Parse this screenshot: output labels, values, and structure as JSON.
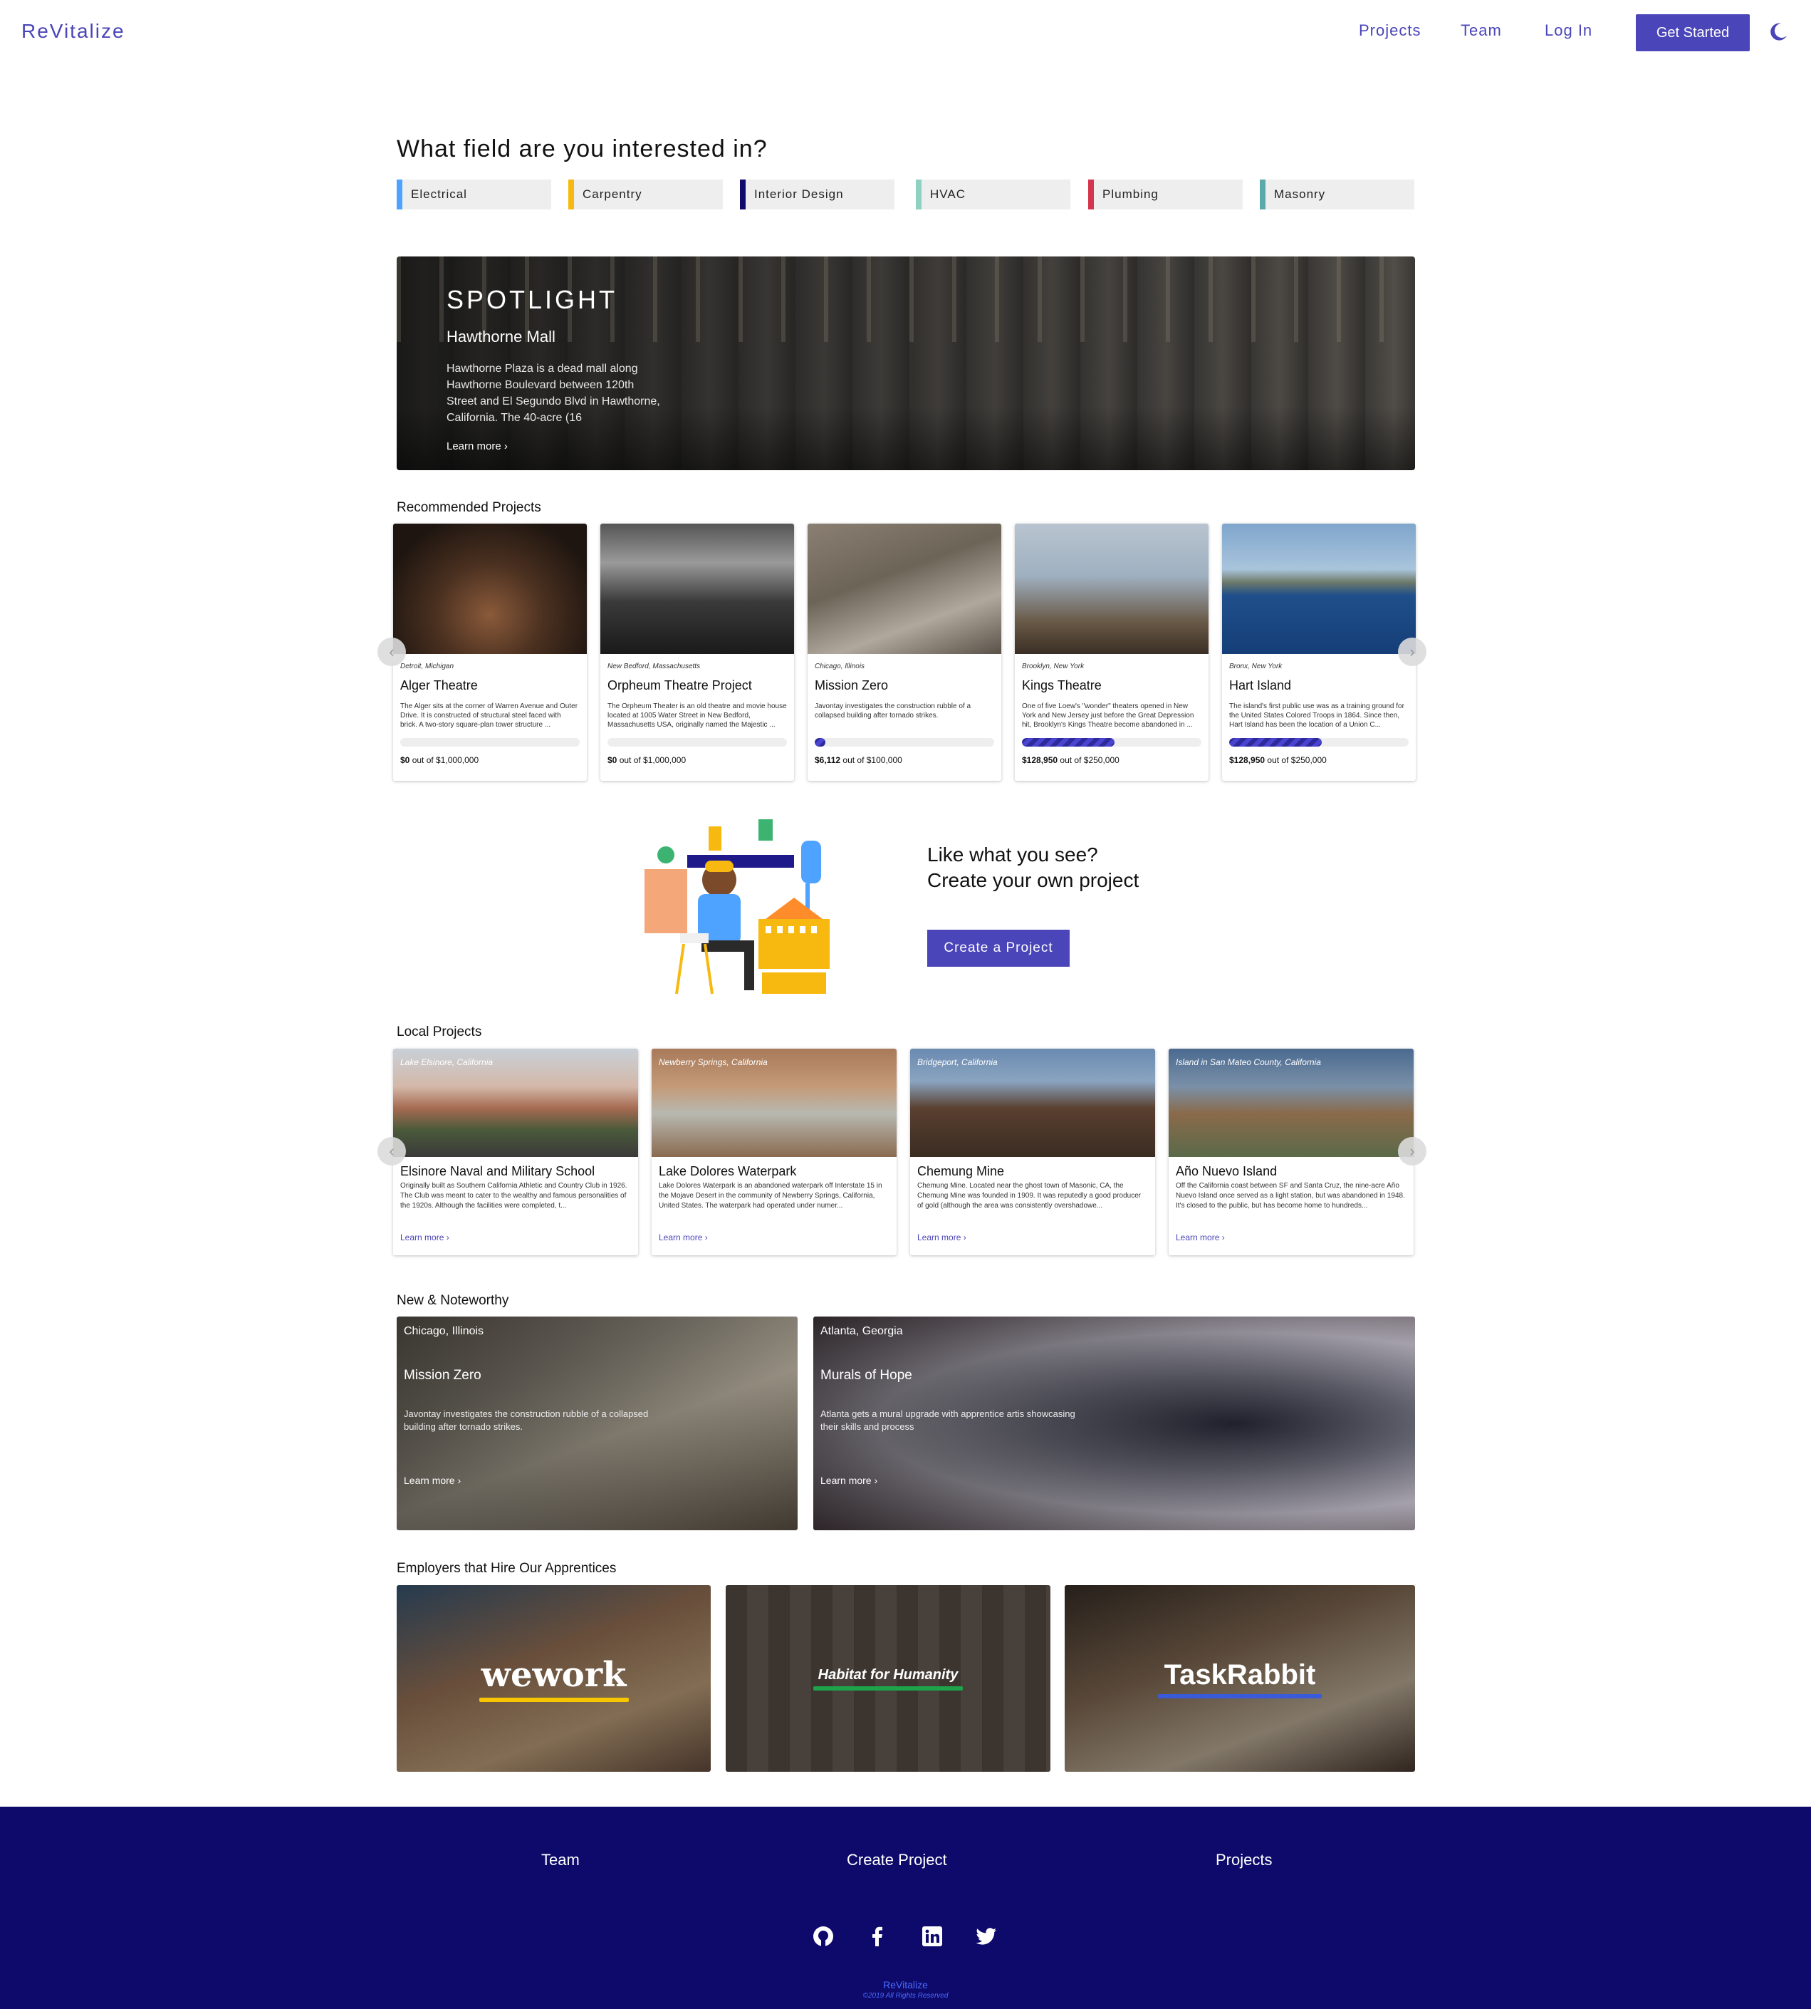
{
  "nav": {
    "brand": "ReVitalize",
    "projects": "Projects",
    "team": "Team",
    "login": "Log In",
    "get_started": "Get Started",
    "theme_icon": "moon-icon"
  },
  "fields": {
    "title": "What field are you interested in?",
    "items": [
      {
        "label": "Electrical",
        "color": "#4da3ff"
      },
      {
        "label": "Carpentry",
        "color": "#f7b90f"
      },
      {
        "label": "Interior Design",
        "color": "#0f0a6b"
      },
      {
        "label": "HVAC",
        "color": "#8fd1c1"
      },
      {
        "label": "Plumbing",
        "color": "#d6334f"
      },
      {
        "label": "Masonry",
        "color": "#5aa8a8"
      }
    ]
  },
  "spotlight": {
    "label": "SPOTLIGHT",
    "name": "Hawthorne Mall",
    "description": "Hawthorne Plaza is a dead mall along Hawthorne Boulevard between 120th Street and El Segundo Blvd in Hawthorne, California. The 40-acre (16",
    "learn_more": "Learn more ›"
  },
  "recommended": {
    "title": "Recommended Projects",
    "items": [
      {
        "location": "Detroit, Michigan",
        "name": "Alger Theatre",
        "description": "The Alger sits at the corner of Warren Avenue and Outer Drive. It is constructed of structural steel faced with brick. A two-story square-plan tower structure ...",
        "raised": "$0",
        "goal_text": "out of $1,000,000",
        "progress": 0
      },
      {
        "location": "New Bedford, Massachusetts",
        "name": "Orpheum Theatre Project",
        "description": "The Orpheum Theater is an old theatre and movie house located at 1005 Water Street in New Bedford, Massachusetts USA, originally named the Majestic ...",
        "raised": "$0",
        "goal_text": "out of $1,000,000",
        "progress": 0
      },
      {
        "location": "Chicago, Illinois",
        "name": "Mission Zero",
        "description": "Javontay investigates the construction rubble of a collapsed building after tornado strikes.",
        "raised": "$6,112",
        "goal_text": "out of $100,000",
        "progress": 0.061
      },
      {
        "location": "Brooklyn, New York",
        "name": "Kings Theatre",
        "description": "One of five Loew's \"wonder\" theaters opened in New York and New Jersey just before the Great Depression hit, Brooklyn's Kings Theatre become abandoned in ...",
        "raised": "$128,950",
        "goal_text": "out of $250,000",
        "progress": 0.516
      },
      {
        "location": "Bronx, New York",
        "name": "Hart Island",
        "description": "The island's first public use was as a training ground for the United States Colored Troops in 1864. Since then, Hart Island has been the location of a Union C...",
        "raised": "$128,950",
        "goal_text": "out of $250,000",
        "progress": 0.516
      }
    ]
  },
  "create": {
    "line1": "Like what you see?",
    "line2": "Create your own project",
    "button": "Create a Project"
  },
  "local": {
    "title": "Local Projects",
    "items": [
      {
        "location": "Lake Elsinore, California",
        "name": "Elsinore Naval and Military School",
        "description": "Originally built as Southern California Athletic and Country Club in 1926. The Club was meant to cater to the wealthy and famous personalities of the 1920s. Although the facilities were completed, t...",
        "learn_more": "Learn more ›"
      },
      {
        "location": "Newberry Springs, California",
        "name": "Lake Dolores Waterpark",
        "description": "Lake Dolores Waterpark is an abandoned waterpark off Interstate 15 in the Mojave Desert in the community of Newberry Springs, California, United States. The waterpark had operated under numer...",
        "learn_more": "Learn more ›"
      },
      {
        "location": "Bridgeport, California",
        "name": "Chemung Mine",
        "description": "Chemung Mine. Located near the ghost town of Masonic, CA, the Chemung Mine was founded in 1909. It was reputedly a good producer of gold (although the area was consistently overshadowe...",
        "learn_more": "Learn more ›"
      },
      {
        "location": "Island in San Mateo County, California",
        "name": "Año Nuevo Island",
        "description": "Off the California coast between SF and Santa Cruz, the nine-acre Año Nuevo Island once served as a light station, but was abandoned in 1948. It's closed to the public, but has become home to hundreds...",
        "learn_more": "Learn more ›"
      }
    ]
  },
  "noteworthy": {
    "title": "New & Noteworthy",
    "items": [
      {
        "location": "Chicago, Illinois",
        "name": "Mission Zero",
        "description": "Javontay investigates the construction rubble of a collapsed building after tornado strikes.",
        "learn_more": "Learn more ›"
      },
      {
        "location": "Atlanta, Georgia",
        "name": "Murals of Hope",
        "description": "Atlanta gets a mural upgrade with apprentice artis showcasing their skills and process",
        "learn_more": "Learn more ›"
      }
    ]
  },
  "employers": {
    "title": "Employers that Hire Our Apprentices",
    "items": [
      {
        "name": "wework",
        "bar_color": "#f7c600"
      },
      {
        "name": "Habitat for Humanity",
        "bar_color": "#1fa34a"
      },
      {
        "name": "TaskRabbit",
        "bar_color": "#3a5bd9"
      }
    ]
  },
  "footer": {
    "team": "Team",
    "create": "Create Project",
    "projects": "Projects",
    "social_icons": [
      "github-icon",
      "facebook-icon",
      "linkedin-icon",
      "twitter-icon"
    ],
    "brand": "ReVitalize",
    "copyright": "©2019 All Rights Reserved"
  },
  "colors": {
    "accent": "#4a45b8",
    "footer_bg": "#0d0a6b"
  }
}
